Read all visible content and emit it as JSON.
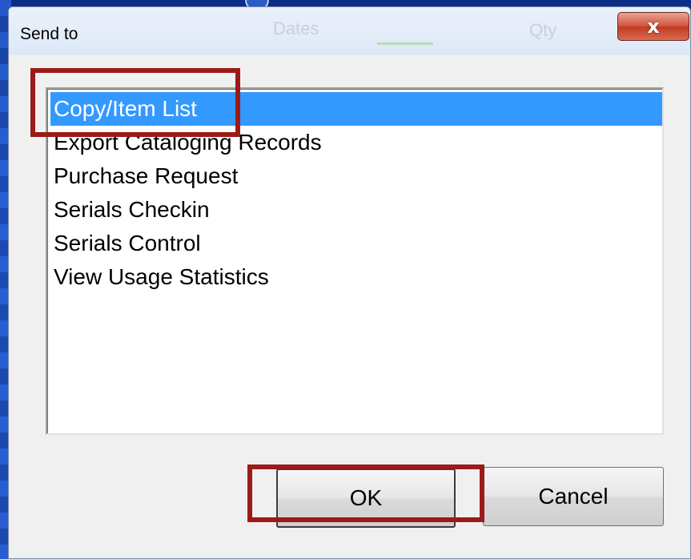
{
  "dialog": {
    "title": "Send to",
    "close_symbol": "x",
    "background_ghost": [
      "Dates",
      "Qty"
    ]
  },
  "list": {
    "selected_index": 0,
    "items": [
      "Copy/Item List",
      "Export Cataloging Records",
      "Purchase Request",
      "Serials Checkin",
      "Serials Control",
      "View Usage Statistics"
    ]
  },
  "buttons": {
    "ok_label": "OK",
    "cancel_label": "Cancel"
  },
  "colors": {
    "selection": "#3399ff",
    "highlight": "#9b1a1a",
    "close_button": "#c23a22"
  },
  "icons": {
    "close": "close-icon"
  }
}
